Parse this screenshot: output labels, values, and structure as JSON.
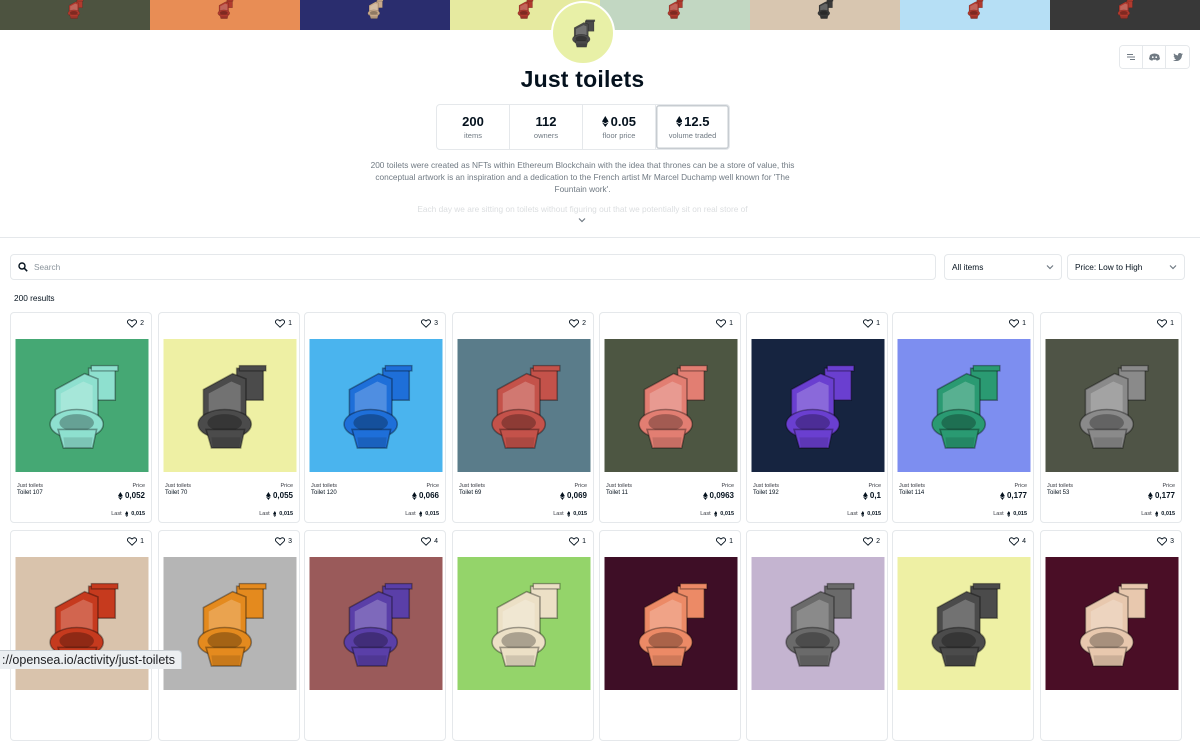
{
  "banner": {
    "tiles": [
      {
        "bg": "#4d5340",
        "toilet": "#b03a2e"
      },
      {
        "bg": "#e88d55",
        "toilet": "#b03a2e"
      },
      {
        "bg": "#2a2d6e",
        "toilet": "#c8a98a"
      },
      {
        "bg": "#e6eaa0",
        "toilet": "#b03a2e"
      },
      {
        "bg": "#c2d7c2",
        "toilet": "#b03a2e"
      },
      {
        "bg": "#d8c6b0",
        "toilet": "#3a3a3a"
      },
      {
        "bg": "#b6dff5",
        "toilet": "#b03a2e"
      },
      {
        "bg": "#383838",
        "toilet": "#b03a2e"
      }
    ]
  },
  "collection": {
    "avatar_bg": "#e8f0a7",
    "avatar_toilet": "#4a4a4a",
    "title": "Just toilets",
    "social": [
      "website-icon",
      "discord-icon",
      "twitter-icon"
    ],
    "stats": [
      {
        "value": "200",
        "label": "items",
        "eth": false
      },
      {
        "value": "112",
        "label": "owners",
        "eth": false
      },
      {
        "value": "0.05",
        "label": "floor price",
        "eth": true
      },
      {
        "value": "12.5",
        "label": "volume traded",
        "eth": true
      }
    ],
    "description_1": "200 toilets were created as NFTs within Ethereum Blockchain with the idea that thrones can be a store of value, this conceptual artwork is an inspiration and a dedication to the French artist",
    "description_link": "Mr Marcel Duchamp",
    "description_2": "well known for 'The Fountain work'.",
    "description_more": "Each day we are sitting on toilets without figuring out that we potentially sit on real store of"
  },
  "filters": {
    "search_placeholder": "Search",
    "items_select": "All items",
    "sort_select": "Price: Low to High",
    "results": "200 results"
  },
  "cards": [
    {
      "collection": "Just toilets",
      "name": "Toilet 107",
      "price_label": "Price",
      "price": "0,052",
      "last_label": "Last",
      "last": "0,015",
      "likes": "2",
      "bg": "#45a874",
      "toilet": "#8ee0cf"
    },
    {
      "collection": "Just toilets",
      "name": "Toilet 70",
      "price_label": "Price",
      "price": "0,055",
      "last_label": "Last",
      "last": "0,015",
      "likes": "1",
      "bg": "#eef0a4",
      "toilet": "#4b4b4b"
    },
    {
      "collection": "Just toilets",
      "name": "Toilet 120",
      "price_label": "Price",
      "price": "0,066",
      "last_label": "Last",
      "last": "0,015",
      "likes": "3",
      "bg": "#4ab4ee",
      "toilet": "#1e6fd9"
    },
    {
      "collection": "Just toilets",
      "name": "Toilet 69",
      "price_label": "Price",
      "price": "0,069",
      "last_label": "Last",
      "last": "0,015",
      "likes": "2",
      "bg": "#5a7c8a",
      "toilet": "#c4524a"
    },
    {
      "collection": "Just toilets",
      "name": "Toilet 11",
      "price_label": "Price",
      "price": "0,0963",
      "last_label": "Last",
      "last": "0,015",
      "likes": "1",
      "bg": "#4d5642",
      "toilet": "#e27e72"
    },
    {
      "collection": "Just toilets",
      "name": "Toilet 192",
      "price_label": "Price",
      "price": "0,1",
      "last_label": "Last",
      "last": "0,015",
      "likes": "1",
      "bg": "#162440",
      "toilet": "#6a3fd0"
    },
    {
      "collection": "Just toilets",
      "name": "Toilet 114",
      "price_label": "Price",
      "price": "0,177",
      "last_label": "Last",
      "last": "0,015",
      "likes": "1",
      "bg": "#7d8ef0",
      "toilet": "#2a9a72"
    },
    {
      "collection": "Just toilets",
      "name": "Toilet 53",
      "price_label": "Price",
      "price": "0,177",
      "last_label": "Last",
      "last": "0,015",
      "likes": "1",
      "bg": "#4f5446",
      "toilet": "#8a8a8a"
    },
    {
      "collection": "",
      "name": "",
      "price_label": "",
      "price": "",
      "last_label": "",
      "last": "",
      "likes": "1",
      "bg": "#d9c3ac",
      "toilet": "#c63a1e"
    },
    {
      "collection": "",
      "name": "",
      "price_label": "",
      "price": "",
      "last_label": "",
      "last": "",
      "likes": "3",
      "bg": "#b5b5b5",
      "toilet": "#e48a1e"
    },
    {
      "collection": "",
      "name": "",
      "price_label": "",
      "price": "",
      "last_label": "",
      "last": "",
      "likes": "4",
      "bg": "#9a5a5a",
      "toilet": "#5a3fa8"
    },
    {
      "collection": "",
      "name": "",
      "price_label": "",
      "price": "",
      "last_label": "",
      "last": "",
      "likes": "1",
      "bg": "#94d46a",
      "toilet": "#ece0c6"
    },
    {
      "collection": "",
      "name": "",
      "price_label": "",
      "price": "",
      "last_label": "",
      "last": "",
      "likes": "1",
      "bg": "#3e0e26",
      "toilet": "#ec8a66"
    },
    {
      "collection": "",
      "name": "",
      "price_label": "",
      "price": "",
      "last_label": "",
      "last": "",
      "likes": "2",
      "bg": "#c4b4d0",
      "toilet": "#6a6a6a"
    },
    {
      "collection": "",
      "name": "",
      "price_label": "",
      "price": "",
      "last_label": "",
      "last": "",
      "likes": "4",
      "bg": "#eef0a4",
      "toilet": "#4b4b4b"
    },
    {
      "collection": "",
      "name": "",
      "price_label": "",
      "price": "",
      "last_label": "",
      "last": "",
      "likes": "3",
      "bg": "#4a0e26",
      "toilet": "#e8c8ae"
    }
  ],
  "status_url": "://opensea.io/activity/just-toilets"
}
